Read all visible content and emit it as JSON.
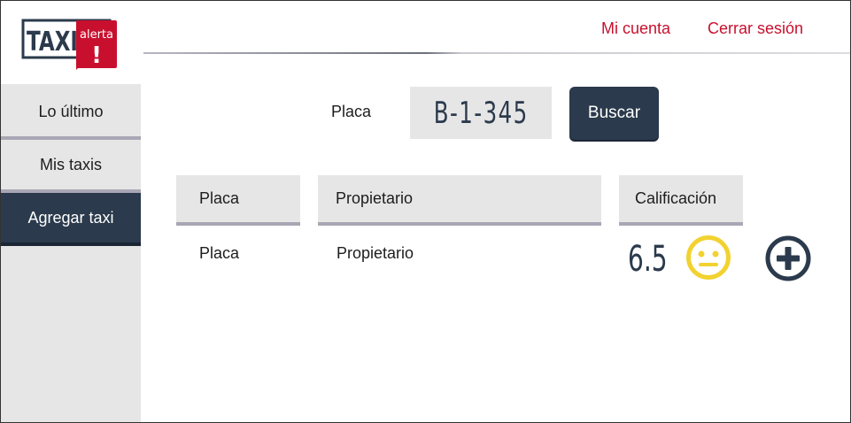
{
  "logo": {
    "text_main": "TAXI",
    "text_badge": "alerta",
    "badge_mark": "!"
  },
  "header": {
    "my_account": "Mi cuenta",
    "logout": "Cerrar sesión"
  },
  "sidebar": {
    "items": [
      {
        "label": "Lo último"
      },
      {
        "label": "Mis taxis"
      },
      {
        "label": "Agregar taxi"
      }
    ],
    "active_index": 2
  },
  "search": {
    "label": "Placa",
    "value": "B-1-345",
    "button": "Buscar"
  },
  "table": {
    "headers": [
      "Placa",
      "Propietario",
      "Calificación"
    ],
    "rows": [
      {
        "placa": "Placa",
        "propietario": "Propietario",
        "calificacion": "6.5",
        "rating_icon": "neutral-face-icon",
        "action_icon": "add-circle-icon"
      }
    ]
  },
  "colors": {
    "brand_red": "#c8102e",
    "navy": "#2b3a4c",
    "panel_gray": "#e6e6e6",
    "divider": "#a9a7b5",
    "face_yellow": "#f2d230"
  }
}
